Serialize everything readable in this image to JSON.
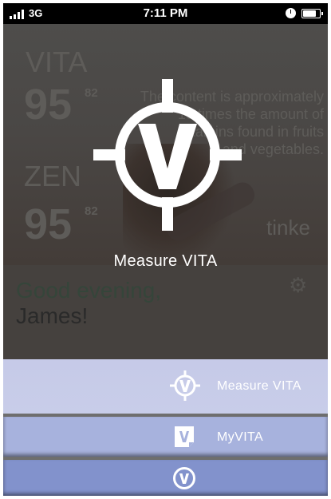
{
  "status_bar": {
    "carrier": "3G",
    "time": "7:11 PM",
    "battery_level": 0.85
  },
  "background": {
    "vita_label": "VITA",
    "vita_value": "95",
    "vita_sup": "82",
    "zen_label": "ZEN",
    "zen_value": "95",
    "zen_sup": "82",
    "text_lines": [
      "The content is approximately",
      "10 times the amount of",
      "vitamins found in fruits",
      "and vegetables."
    ],
    "brand_text": "tinke",
    "greeting": "Good evening,",
    "user_name": "James!",
    "gear_icon": "gear-icon"
  },
  "overlay": {
    "icon": "vita-crosshair-logo",
    "title": "Measure VITA"
  },
  "menu": {
    "items": [
      {
        "icon": "crosshair-v-icon",
        "label": "Measure VITA",
        "color": "#c6cae8"
      },
      {
        "icon": "document-v-icon",
        "label": "MyVITA",
        "color": "#a7b2dd"
      },
      {
        "icon": "circle-v-icon",
        "label": "",
        "color": "#8292cc"
      }
    ]
  }
}
